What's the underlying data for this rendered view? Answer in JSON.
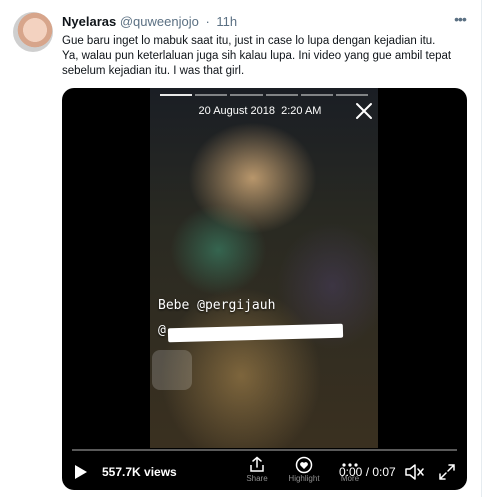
{
  "tweet": {
    "author_name": "Nyelaras",
    "author_handle": "@quweenjojo",
    "separator": "·",
    "time": "11h",
    "text_lines": [
      "Gue baru inget lo mabuk saat itu, just in case lo lupa dengan kejadian itu.",
      "Ya, walau pun keterlaluan juga sih kalau lupa. Ini video yang gue ambil tepat",
      "sebelum kejadian itu. I was that girl."
    ]
  },
  "video": {
    "story_date": "20 August 2018",
    "story_time": "2:20 AM",
    "sticker_line1": "Bebe @pergijauh",
    "sticker_line2": "@",
    "views_count": "557.7K views",
    "actions": {
      "share_label": "Share",
      "highlight_label": "Highlight",
      "more_label": "More"
    },
    "elapsed": "0:00",
    "duration": "0:07",
    "time_separator": " / ",
    "progress_fraction": 0.0
  },
  "colors": {
    "name": "#0f1419",
    "secondary": "#5b7083",
    "video_bg": "#000000",
    "overlay_text": "#ffffff"
  },
  "icons": {
    "more": "more-horizontal-icon",
    "close": "close-icon",
    "play": "play-icon",
    "share": "share-icon",
    "highlight": "highlight-icon",
    "more_action": "more-icon",
    "mute": "mute-icon",
    "expand": "expand-icon"
  }
}
